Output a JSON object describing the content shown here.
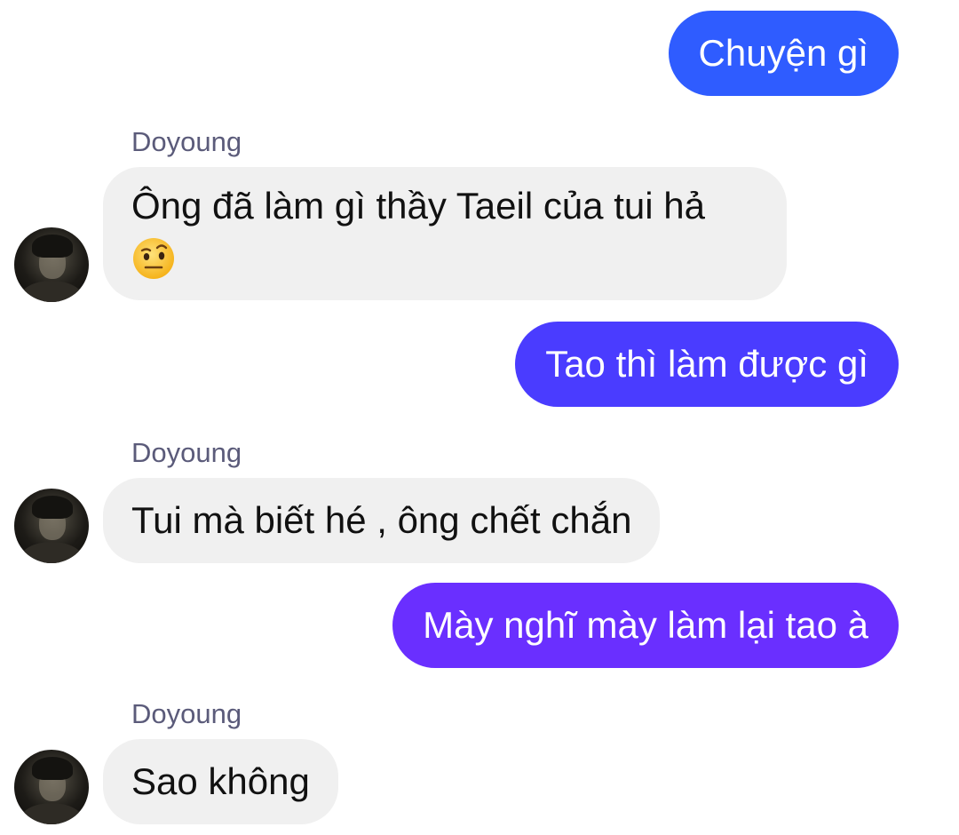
{
  "conversation": {
    "messages": [
      {
        "direction": "outgoing",
        "text": "Chuyện gì",
        "color": "#2f5cff"
      },
      {
        "direction": "incoming",
        "sender": "Doyoung",
        "text": "Ông đã làm gì thầy Taeil của tui hả",
        "emoji": "face-with-raised-eyebrow-emoji"
      },
      {
        "direction": "outgoing",
        "text": "Tao thì làm được gì",
        "color": "#4a3cff"
      },
      {
        "direction": "incoming",
        "sender": "Doyoung",
        "text": "Tui mà biết hé , ông chết chắn"
      },
      {
        "direction": "outgoing",
        "text": "Mày nghĩ mày làm lại tao à",
        "color": "#6a2fff"
      },
      {
        "direction": "incoming",
        "sender": "Doyoung",
        "text": "Sao không"
      }
    ]
  },
  "colors": {
    "incoming_bubble": "#f0f0f0",
    "sender_name": "#5b5b7a",
    "background": "#ffffff"
  }
}
